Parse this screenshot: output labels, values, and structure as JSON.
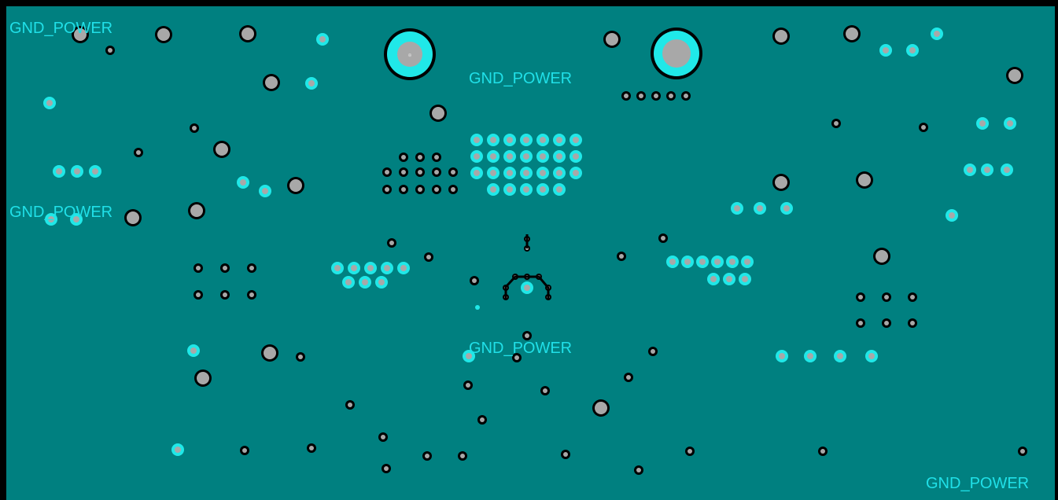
{
  "net_labels": [
    "GND_POWER",
    "GND_POWER",
    "GND_POWER",
    "GND_POWER",
    "GND_POWER"
  ],
  "colors": {
    "border": "#000000",
    "plane": "#008080",
    "pad_gray": "#a8a8a8",
    "pad_cyan": "#20e8e8",
    "ring_black": "#000000",
    "label": "#20e0e8"
  },
  "mount_hole_mark": "⊕"
}
